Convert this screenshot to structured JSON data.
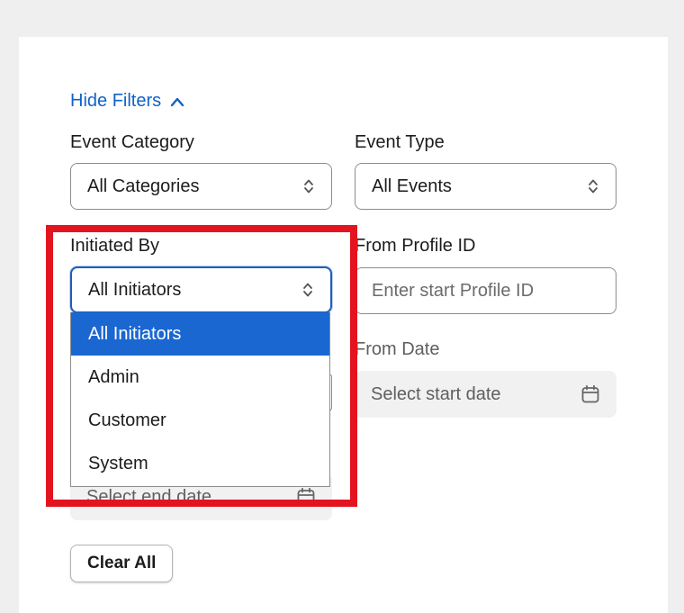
{
  "filters": {
    "toggle_label": "Hide Filters",
    "event_category": {
      "label": "Event Category",
      "value": "All Categories"
    },
    "event_type": {
      "label": "Event Type",
      "value": "All Events"
    },
    "initiated_by": {
      "label": "Initiated By",
      "value": "All Initiators",
      "options": [
        "All Initiators",
        "Admin",
        "Customer",
        "System"
      ]
    },
    "from_profile_id": {
      "label": "From Profile ID",
      "placeholder": "Enter start Profile ID"
    },
    "from_date": {
      "label": "From Date",
      "placeholder": "Select start date"
    },
    "to_date": {
      "placeholder": "Select end date"
    },
    "clear_all_label": "Clear All"
  },
  "icons": {
    "toggle": "chevron-up-icon",
    "select_caret": "updown-chevron-icon",
    "date": "calendar-icon"
  },
  "colors": {
    "link": "#0f62c9",
    "selected_option": "#1a67d2",
    "annotation": "#e3141f"
  }
}
